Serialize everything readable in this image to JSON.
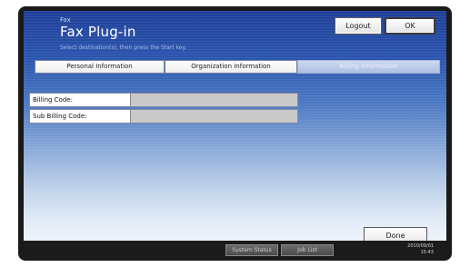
{
  "header": {
    "mode_label": "Fax",
    "title": "Fax Plug-in",
    "instruction": "Select destination(s), then press the Start key.",
    "logout_label": "Logout",
    "ok_label": "OK"
  },
  "tabs": [
    {
      "label": "Personal Information",
      "active": false
    },
    {
      "label": "Organization Information",
      "active": false
    },
    {
      "label": "Billing Information",
      "active": true
    }
  ],
  "form": {
    "billing_code_label": "Billing Code:",
    "billing_code_value": "",
    "sub_billing_code_label": "Sub Billing Code:",
    "sub_billing_code_value": ""
  },
  "actions": {
    "done_label": "Done"
  },
  "status_bar": {
    "system_status_label": "System Status",
    "job_list_label": "Job List",
    "date": "2010/09/01",
    "time": "15:43"
  }
}
